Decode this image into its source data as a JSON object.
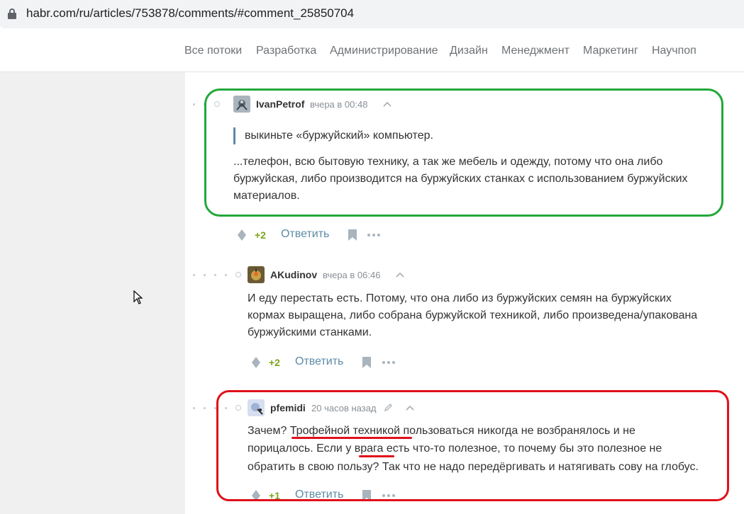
{
  "browser": {
    "url": "habr.com/ru/articles/753878/comments/#comment_25850704"
  },
  "nav": {
    "items": [
      "Все потоки",
      "Разработка",
      "Администрирование",
      "Дизайн",
      "Менеджмент",
      "Маркетинг",
      "Научпоп"
    ]
  },
  "comments": [
    {
      "username": "IvanPetrof",
      "time": "вчера в 00:48",
      "quote": "выкиньте «буржуйский» компьютер.",
      "lines": [
        "...телефон, всю бытовую технику, а так же мебель и одежду, потому что она либо",
        "буржуйская, либо производится на буржуйских станках с использованием буржуйских",
        "материалов."
      ],
      "score": "+2",
      "reply_label": "Ответить"
    },
    {
      "username": "AKudinov",
      "time": "вчера в 06:46",
      "lines": [
        "И еду перестать есть. Потому, что она либо из буржуйских семян на буржуйских",
        "кормах выращена, либо собрана буржуйской техникой, либо произведена/упакована",
        "буржуйскими станками."
      ],
      "score": "+2",
      "reply_label": "Ответить"
    },
    {
      "username": "pfemidi",
      "time": "20 часов назад",
      "lines": [
        "Зачем? Трофейной техникой пользоваться никогда не возбранялось и не",
        "порицалось. Если у врага есть что-то полезное, то почему бы это полезное не",
        "обратить в свою пользу? Так что не надо передёргивать и натягивать сову на глобус."
      ],
      "score": "+1",
      "reply_label": "Ответить"
    }
  ],
  "colors": {
    "highlight_green": "#22a83a",
    "highlight_red": "#e0101a",
    "link": "#5e8aa7",
    "score": "#7ba41a"
  }
}
